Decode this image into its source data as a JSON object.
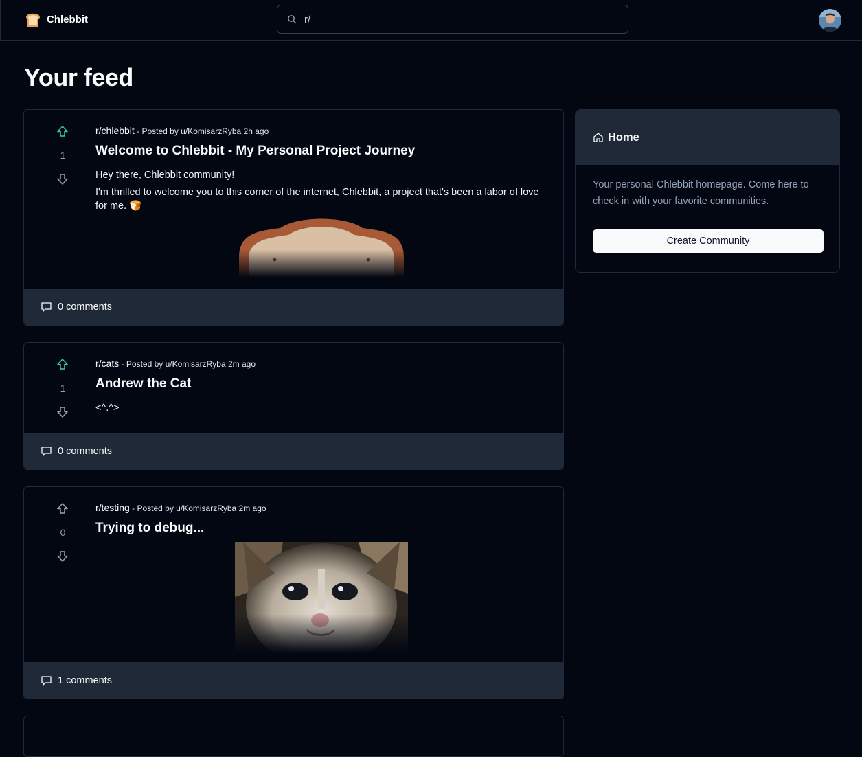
{
  "header": {
    "brand_name": "Chlebbit",
    "logo_icon": "bread-icon",
    "search": {
      "value": "r/",
      "icon": "search-icon"
    },
    "avatar_icon": "user-avatar"
  },
  "main": {
    "title": "Your feed"
  },
  "posts": [
    {
      "subreddit": "r/chlebbit",
      "posted_by": " - Posted by u/KomisarzRyba 2h ago",
      "votes": "1",
      "vote_state": "up",
      "title": "Welcome to Chlebbit - My Personal Project Journey",
      "body": [
        "Hey there, Chlebbit community!",
        "I'm thrilled to welcome you to this corner of the internet, Chlebbit, a project that's been a labor of love for me. 🍞"
      ],
      "image": "bread-image",
      "comments": "0 comments"
    },
    {
      "subreddit": "r/cats",
      "posted_by": " - Posted by u/KomisarzRyba 2m ago",
      "votes": "1",
      "vote_state": "up",
      "title": "Andrew the Cat",
      "body": [
        "<^.^>"
      ],
      "comments": "0 comments"
    },
    {
      "subreddit": "r/testing",
      "posted_by": " - Posted by u/KomisarzRyba 2m ago",
      "votes": "0",
      "vote_state": "none",
      "title": "Trying to debug...",
      "image": "crying-cat-image",
      "comments": "1 comments"
    }
  ],
  "sidebar": {
    "title": "Home",
    "icon": "home-icon",
    "description": "Your personal Chlebbit homepage. Come here to check in with your favorite communities.",
    "button": "Create Community"
  },
  "colors": {
    "background": "#030712",
    "card_footer": "#1f2937",
    "upvote_active": "#34d399",
    "vote_inactive": "#94a3b8"
  }
}
